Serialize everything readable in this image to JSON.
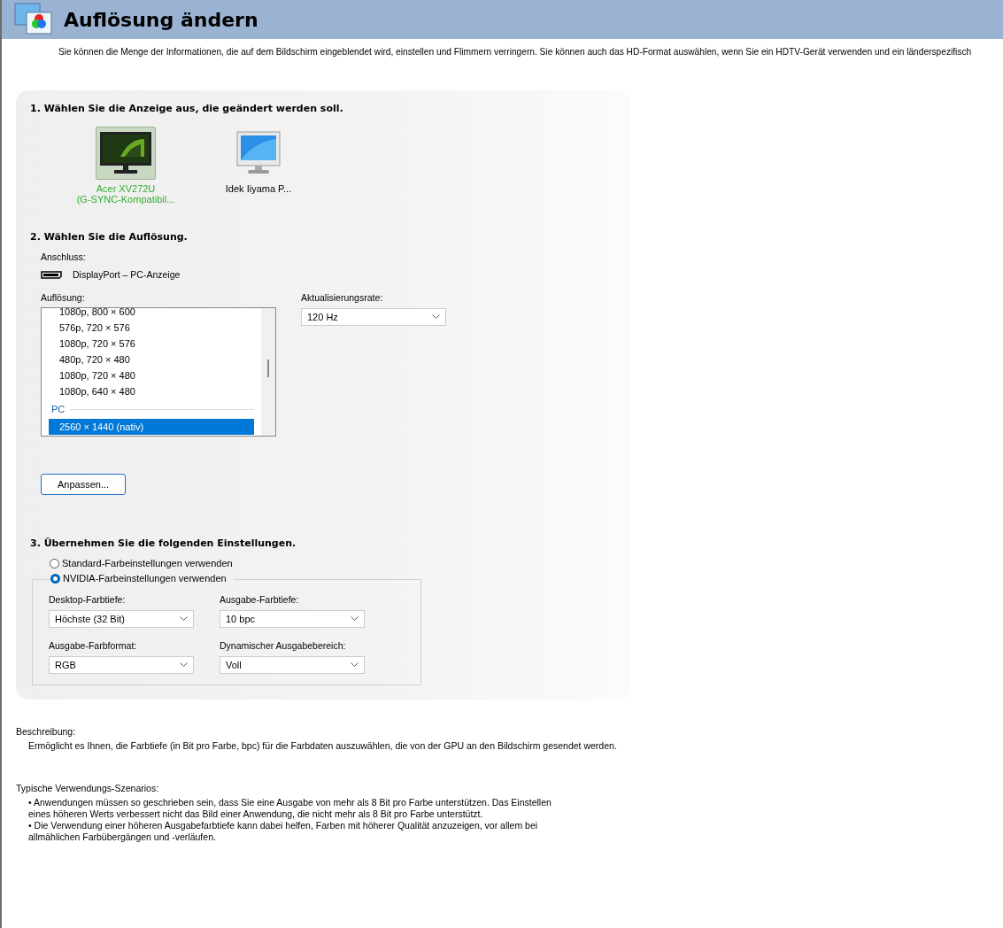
{
  "header": {
    "title": "Auflösung ändern"
  },
  "intro": "Sie können die Menge der Informationen, die auf dem Bildschirm eingeblendet wird, einstellen und Flimmern verringern. Sie können auch das HD-Format auswählen, wenn Sie ein HDTV-Gerät verwenden und ein länderspezifisch",
  "step1": {
    "heading": "1. Wählen Sie die Anzeige aus, die geändert werden soll.",
    "displays": [
      {
        "kind": "nvidia",
        "name": "Acer XV272U",
        "subtitle": "(G-SYNC-Kompatibil...",
        "selected": true
      },
      {
        "kind": "generic",
        "name": "Idek Iiyama P...",
        "selected": false
      }
    ]
  },
  "step2": {
    "heading": "2. Wählen Sie die Auflösung.",
    "connection_label": "Anschluss:",
    "connection": "DisplayPort – PC-Anzeige",
    "resolution_label": "Auflösung:",
    "resolutions": [
      {
        "kind": "item",
        "label": "1080p, 800 × 600",
        "selected": false
      },
      {
        "kind": "item",
        "label": "576p, 720 × 576",
        "selected": false
      },
      {
        "kind": "item",
        "label": "1080p, 720 × 576",
        "selected": false
      },
      {
        "kind": "item",
        "label": "480p, 720 × 480",
        "selected": false
      },
      {
        "kind": "item",
        "label": "1080p, 720 × 480",
        "selected": false
      },
      {
        "kind": "item",
        "label": "1080p, 640 × 480",
        "selected": false
      },
      {
        "kind": "group",
        "label": "PC"
      },
      {
        "kind": "item",
        "label": "2560 × 1440 (nativ)",
        "selected": true
      }
    ],
    "refresh_label": "Aktualisierungsrate:",
    "refresh_value": "120 Hz",
    "customize_button": "Anpassen..."
  },
  "step3": {
    "heading": "3. Übernehmen Sie die folgenden Einstellungen.",
    "options": [
      {
        "label": "Standard-Farbeinstellungen verwenden",
        "selected": false
      },
      {
        "label": "NVIDIA-Farbeinstellungen verwenden",
        "selected": true
      }
    ],
    "fields": [
      {
        "label": "Desktop-Farbtiefe:",
        "value": "Höchste (32 Bit)"
      },
      {
        "label": "Ausgabe-Farbtiefe:",
        "value": "10 bpc"
      },
      {
        "label": "Ausgabe-Farbformat:",
        "value": "RGB"
      },
      {
        "label": "Dynamischer Ausgabebereich:",
        "value": "Voll"
      }
    ]
  },
  "description": {
    "label": "Beschreibung:",
    "text": "Ermöglicht es Ihnen, die Farbtiefe (in Bit pro Farbe, bpc) für die Farbdaten auszuwählen, die von der GPU an den Bildschirm gesendet werden."
  },
  "scenarios": {
    "label": "Typische Verwendungs-Szenarios:",
    "items": [
      "• Anwendungen müssen so geschrieben sein, dass Sie eine Ausgabe von mehr als 8 Bit pro Farbe unterstützen. Das Einstellen eines höheren Werts verbessert nicht das Bild einer Anwendung, die nicht mehr als 8 Bit pro Farbe unterstützt.",
      "• Die Verwendung einer höheren Ausgabefarbtiefe kann dabei helfen, Farben mit höherer Qualität anzuzeigen, vor allem bei allmählichen Farbübergängen und -verläufen."
    ]
  }
}
